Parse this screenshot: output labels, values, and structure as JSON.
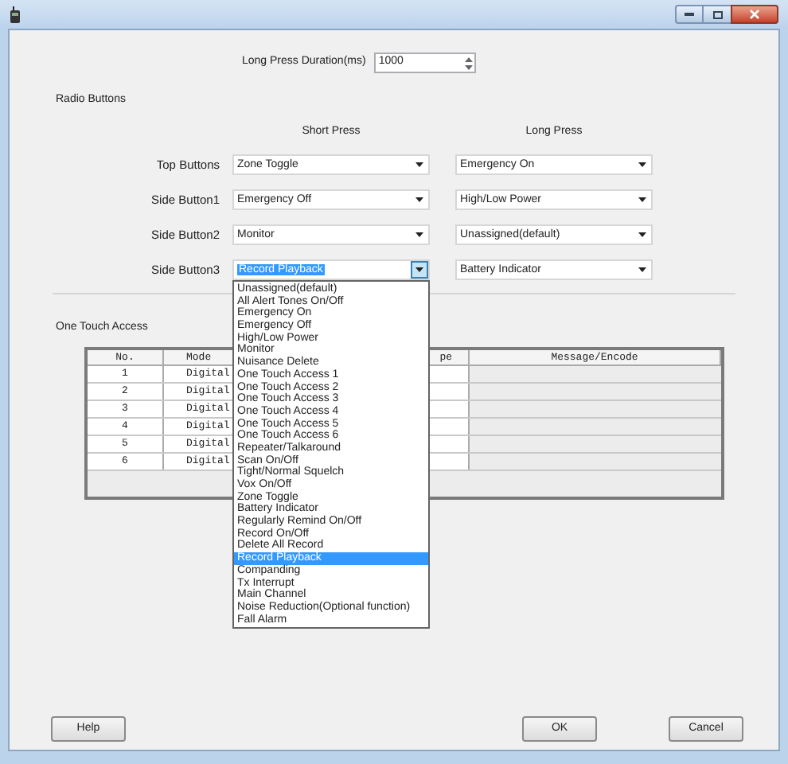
{
  "long_press_duration": {
    "label": "Long Press Duration(ms)",
    "value": "1000"
  },
  "radio_buttons": {
    "title": "Radio Buttons",
    "headers": [
      "Short Press",
      "Long Press"
    ],
    "rows": [
      {
        "label": "Top Buttons",
        "short_press": {
          "value": "Zone Toggle",
          "open": false
        },
        "long_press": {
          "value": "Emergency On",
          "open": false
        }
      },
      {
        "label": "Side Button1",
        "short_press": {
          "value": "Emergency Off",
          "open": false
        },
        "long_press": {
          "value": "High/Low Power",
          "open": false
        }
      },
      {
        "label": "Side Button2",
        "short_press": {
          "value": "Monitor",
          "open": false
        },
        "long_press": {
          "value": "Unassigned(default)",
          "open": false
        }
      },
      {
        "label": "Side Button3",
        "short_press": {
          "value": "Record Playback",
          "open": true,
          "options": [
            {
              "label": "Unassigned(default)",
              "selected": false
            },
            {
              "label": "All Alert Tones On/Off",
              "selected": false
            },
            {
              "label": "Emergency On",
              "selected": false
            },
            {
              "label": "Emergency Off",
              "selected": false
            },
            {
              "label": "High/Low Power",
              "selected": false
            },
            {
              "label": "Monitor",
              "selected": false
            },
            {
              "label": "Nuisance Delete",
              "selected": false
            },
            {
              "label": "One Touch Access 1",
              "selected": false
            },
            {
              "label": "One Touch Access 2",
              "selected": false
            },
            {
              "label": "One Touch Access 3",
              "selected": false
            },
            {
              "label": "One Touch Access 4",
              "selected": false
            },
            {
              "label": "One Touch Access 5",
              "selected": false
            },
            {
              "label": "One Touch Access 6",
              "selected": false
            },
            {
              "label": "Repeater/Talkaround",
              "selected": false
            },
            {
              "label": "Scan On/Off",
              "selected": false
            },
            {
              "label": "Tight/Normal Squelch",
              "selected": false
            },
            {
              "label": "Vox On/Off",
              "selected": false
            },
            {
              "label": "Zone Toggle",
              "selected": false
            },
            {
              "label": "Battery Indicator",
              "selected": false
            },
            {
              "label": "Regularly Remind On/Off",
              "selected": false
            },
            {
              "label": "Record On/Off",
              "selected": false
            },
            {
              "label": "Delete All Record",
              "selected": false
            },
            {
              "label": "Record Playback",
              "selected": true
            },
            {
              "label": "Companding",
              "selected": false
            },
            {
              "label": "Tx Interrupt",
              "selected": false
            },
            {
              "label": "Main Channel",
              "selected": false
            },
            {
              "label": "Noise Reduction(Optional function)",
              "selected": false
            },
            {
              "label": "Fall Alarm",
              "selected": false
            }
          ]
        },
        "long_press": {
          "value": "Battery Indicator",
          "open": false
        }
      }
    ]
  },
  "one_touch_access": {
    "title": "One Touch Access",
    "columns": [
      "No.",
      "Mode",
      "pe",
      "Message/Encode"
    ],
    "rows": [
      {
        "no": "1",
        "mode": "Digital"
      },
      {
        "no": "2",
        "mode": "Digital"
      },
      {
        "no": "3",
        "mode": "Digital"
      },
      {
        "no": "4",
        "mode": "Digital"
      },
      {
        "no": "5",
        "mode": "Digital"
      },
      {
        "no": "6",
        "mode": "Digital"
      }
    ]
  },
  "buttons": [
    "Help",
    "OK",
    "Cancel"
  ]
}
